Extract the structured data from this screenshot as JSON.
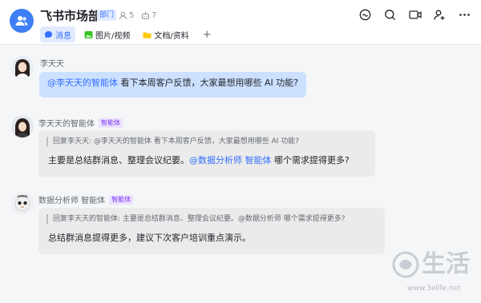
{
  "header": {
    "title": "飞书市场部",
    "dept_badge": "部门",
    "member_count": "5",
    "bot_count": "7",
    "tabs": [
      {
        "label": "消息",
        "icon": "chat-bubble-icon"
      },
      {
        "label": "图片/视频",
        "icon": "image-icon"
      },
      {
        "label": "文档/资料",
        "icon": "folder-icon"
      }
    ],
    "add_tab": "+",
    "actions": [
      "meeting-icon",
      "search-icon",
      "video-call-icon",
      "add-member-icon",
      "more-icon"
    ]
  },
  "messages": [
    {
      "sender": "李天天",
      "mention": "@李天天的智能体",
      "text": " 看下本周客户反馈，大家最想用哪些 AI 功能?"
    },
    {
      "sender": "李天天的智能体",
      "badge": "智能体",
      "quote": "回复李天天: @李天天的智能体 看下本周客户反馈，大家最想用哪些 AI 功能?",
      "text_before": "主要是总结群消息、整理会议纪要。",
      "mention": "@数据分析师 智能体",
      "text_after": " 哪个需求提得更多?"
    },
    {
      "sender": "数据分析师 智能体",
      "badge": "智能体",
      "quote": "回复李天天的智能体: 主要是总结群消息、整理会议纪要。@数据分析师 哪个需求提得更多?",
      "text": "总结群消息提得更多，建议下次客户培训重点演示。"
    }
  ],
  "watermark": {
    "text": "生活",
    "url": "www.3elife.net"
  },
  "colors": {
    "accent": "#3370ff",
    "self_bubble": "#cce0ff",
    "other_bubble": "#ebebeb",
    "bot_badge_bg": "#ece2fe",
    "bot_badge_fg": "#7f3bf5"
  }
}
